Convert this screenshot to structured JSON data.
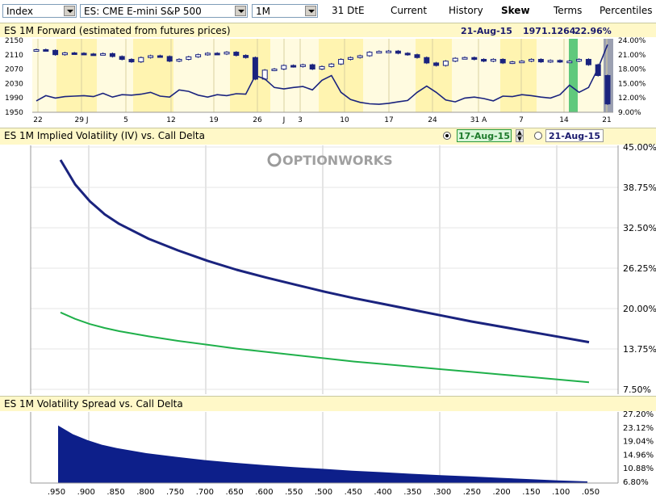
{
  "toolbar": {
    "index_select": "Index",
    "instrument_select": "ES: CME E-mini S&P 500",
    "tenor_select": "1M",
    "dte": "31 DtE",
    "tabs": [
      "Current",
      "History",
      "Skew",
      "Terms",
      "Percentiles"
    ],
    "active_tab": "Skew"
  },
  "forward_panel": {
    "title": "ES 1M Forward (estimated from futures prices)",
    "date": "21-Aug-15",
    "price": "1971.1264",
    "vol": "22.96%"
  },
  "iv_panel": {
    "title": "ES 1M Implied Volatility (IV) vs. Call Delta",
    "date1": "17-Aug-15",
    "date2": "21-Aug-15",
    "logo": "OPTIONWORKS"
  },
  "spread_panel": {
    "title": "ES 1M Volatility Spread vs. Call Delta"
  },
  "chart_data": [
    {
      "type": "line",
      "title": "ES 1M Forward (estimated from futures prices)",
      "x_ticks": [
        "22",
        "29 J",
        "5",
        "12",
        "19",
        "26",
        "J",
        "3",
        "10",
        "17",
        "24",
        "31 A",
        "7",
        "14",
        "21"
      ],
      "y_ticks": [
        "2150",
        "2110",
        "2070",
        "2030",
        "1990",
        "1950"
      ],
      "y2_ticks": [
        "24.00%",
        "21.00%",
        "18.00%",
        "15.00%",
        "12.00%",
        "9.00%"
      ],
      "ylim": [
        1950,
        2150
      ],
      "y2lim": [
        9,
        24
      ],
      "series": [
        {
          "values": [
            2122,
            2120,
            2108,
            2113,
            2112,
            2110,
            2109,
            2111,
            2103,
            2095,
            2088,
            2100,
            2105,
            2103,
            2090,
            2095,
            2102,
            2108,
            2112,
            2110,
            2115,
            2106,
            2100,
            2040,
            2065,
            2068,
            2078,
            2075,
            2080,
            2068,
            2075,
            2082,
            2095,
            2100,
            2105,
            2115,
            2117,
            2118,
            2112,
            2108,
            2100,
            2085,
            2078,
            2090,
            2098,
            2100,
            2095,
            2090,
            2095,
            2085,
            2088,
            2090,
            2095,
            2088,
            2092,
            2088,
            2090,
            2095,
            2080,
            2050,
            1971
          ]
        },
        {
          "values": [
            11.2,
            12.3,
            11.8,
            12.1,
            12.2,
            12.3,
            12.1,
            12.8,
            12.0,
            12.5,
            12.4,
            12.6,
            13.0,
            12.2,
            12.0,
            13.5,
            13.2,
            12.4,
            12.0,
            12.5,
            12.3,
            12.7,
            12.6,
            16.5,
            15.8,
            14.0,
            13.7,
            14.0,
            14.2,
            13.5,
            15.5,
            16.5,
            13.0,
            11.5,
            10.9,
            10.6,
            10.5,
            10.7,
            11.0,
            11.3,
            13.0,
            14.3,
            13.0,
            11.4,
            11.0,
            11.8,
            12.0,
            11.7,
            11.2,
            12.2,
            12.1,
            12.5,
            12.3,
            12.0,
            11.8,
            12.5,
            14.5,
            13.0,
            14.0,
            18.0,
            22.96
          ]
        }
      ]
    },
    {
      "type": "line",
      "title": "ES 1M Implied Volatility (IV) vs. Call Delta",
      "x": [
        0.95,
        0.925,
        0.9,
        0.875,
        0.85,
        0.8,
        0.75,
        0.7,
        0.65,
        0.6,
        0.55,
        0.5,
        0.45,
        0.4,
        0.35,
        0.3,
        0.25,
        0.2,
        0.15,
        0.1,
        0.05
      ],
      "y_ticks": [
        "45.00%",
        "38.75%",
        "32.50%",
        "26.25%",
        "20.00%",
        "13.75%",
        "7.50%"
      ],
      "ylim": [
        7.5,
        45
      ],
      "series": [
        {
          "name": "21-Aug-15",
          "values": [
            43.0,
            39.2,
            36.6,
            34.6,
            33.1,
            30.8,
            29.0,
            27.4,
            26.0,
            24.8,
            23.7,
            22.6,
            21.6,
            20.7,
            19.8,
            18.9,
            18.0,
            17.2,
            16.4,
            15.6,
            14.8
          ]
        },
        {
          "name": "17-Aug-15",
          "values": [
            19.4,
            18.4,
            17.6,
            17.0,
            16.5,
            15.7,
            15.0,
            14.4,
            13.8,
            13.3,
            12.8,
            12.3,
            11.8,
            11.4,
            11.0,
            10.6,
            10.2,
            9.8,
            9.4,
            9.0,
            8.6
          ]
        }
      ]
    },
    {
      "type": "area",
      "title": "ES 1M Volatility Spread vs. Call Delta",
      "x_ticks": [
        ".950",
        ".900",
        ".850",
        ".800",
        ".750",
        ".700",
        ".650",
        ".600",
        ".550",
        ".500",
        ".450",
        ".400",
        ".350",
        ".300",
        ".250",
        ".200",
        ".150",
        ".100",
        ".050"
      ],
      "x": [
        0.95,
        0.925,
        0.9,
        0.875,
        0.85,
        0.8,
        0.75,
        0.7,
        0.65,
        0.6,
        0.55,
        0.5,
        0.45,
        0.4,
        0.35,
        0.3,
        0.25,
        0.2,
        0.15,
        0.1,
        0.05
      ],
      "y_ticks": [
        "27.20%",
        "23.12%",
        "19.04%",
        "14.96%",
        "10.88%",
        "6.80%"
      ],
      "ylim": [
        6.8,
        27.2
      ],
      "values": [
        23.6,
        21.0,
        19.2,
        17.8,
        16.8,
        15.3,
        14.2,
        13.2,
        12.4,
        11.7,
        11.1,
        10.6,
        10.0,
        9.6,
        9.1,
        8.7,
        8.3,
        7.9,
        7.5,
        7.1,
        6.8
      ]
    }
  ]
}
